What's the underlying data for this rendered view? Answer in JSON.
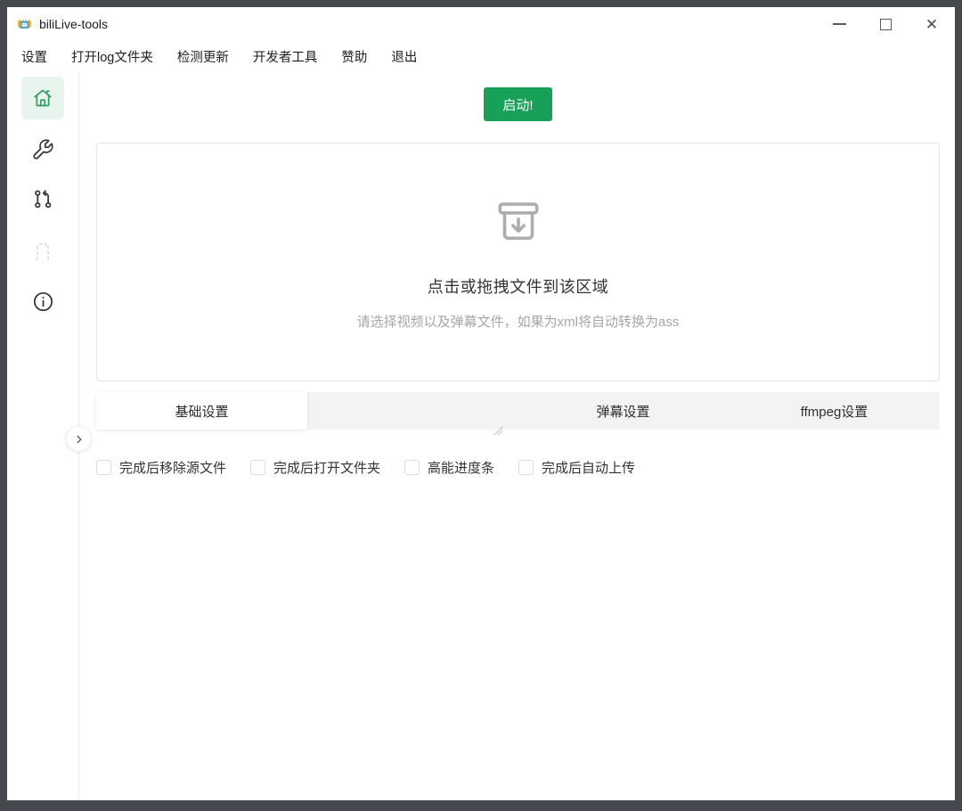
{
  "window": {
    "title": "biliLive-tools",
    "controls": {
      "close_glyph": "✕"
    }
  },
  "menu": {
    "items": [
      "设置",
      "打开log文件夹",
      "检测更新",
      "开发者工具",
      "赞助",
      "退出"
    ]
  },
  "sidebar": {
    "items": [
      {
        "icon": "home-icon",
        "active": true
      },
      {
        "icon": "wrench-icon",
        "active": false
      },
      {
        "icon": "git-branch-icon",
        "active": false
      },
      {
        "icon": "dashed-shape-icon",
        "active": false
      },
      {
        "icon": "info-icon",
        "active": false
      }
    ]
  },
  "main": {
    "start_button_label": "启动!",
    "dropzone": {
      "title": "点击或拖拽文件到该区域",
      "subtitle": "请选择视频以及弹幕文件，如果为xml将自动转换为ass"
    },
    "tabs": [
      {
        "label": "基础设置",
        "active": true
      },
      {
        "label": "弹幕设置",
        "active": false
      },
      {
        "label": "ffmpeg设置",
        "active": false
      }
    ],
    "options": [
      {
        "label": "完成后移除源文件",
        "checked": false
      },
      {
        "label": "完成后打开文件夹",
        "checked": false
      },
      {
        "label": "高能进度条",
        "checked": false
      },
      {
        "label": "完成后自动上传",
        "checked": false
      }
    ]
  },
  "colors": {
    "accent_green": "#18a058",
    "active_item_bg": "#e7f5ee",
    "frame_border": "#45494d"
  }
}
